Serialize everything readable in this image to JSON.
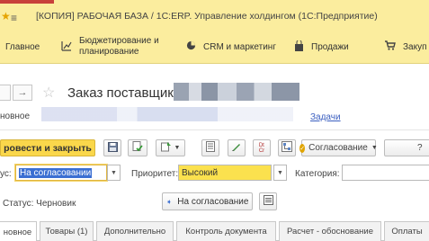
{
  "window": {
    "menu_icon": "hamburger-icon",
    "title": "[КОПИЯ] РАБОЧАЯ БАЗА / 1С:ERP. Управление холдингом (1С:Предприятие)"
  },
  "sections": [
    {
      "label": "Главное",
      "icon": "home-icon"
    },
    {
      "label_line1": "Бюджетирование и",
      "label_line2": "планирование",
      "icon": "chart-icon"
    },
    {
      "label": "CRM и маркетинг",
      "icon": "pie-icon"
    },
    {
      "label": "Продажи",
      "icon": "bag-icon"
    },
    {
      "label": "Закуп",
      "icon": "cart-icon"
    }
  ],
  "document": {
    "title": "Заказ поставщику",
    "section_tab": "новное",
    "tasks_link": "Задачи"
  },
  "toolbar": {
    "post_close": "ровести и закрыть",
    "approval": "Согласование",
    "help": "?"
  },
  "fields": {
    "status_label": "ус:",
    "status_value": "На согласовании",
    "priority_label": "Приоритет:",
    "priority_value": "Высокий",
    "category_label": "Категория:",
    "category_value": ""
  },
  "status_line": {
    "text": "Статус: Черновик",
    "button": "На согласование"
  },
  "tabs": [
    "новное",
    "Товары (1)",
    "Дополнительно",
    "Контроль документа",
    "Расчет - обоснование",
    "Оплаты"
  ],
  "colors": {
    "accent": "#fbed9e",
    "primary_button": "#fad74b",
    "link": "#3b5fc0"
  }
}
